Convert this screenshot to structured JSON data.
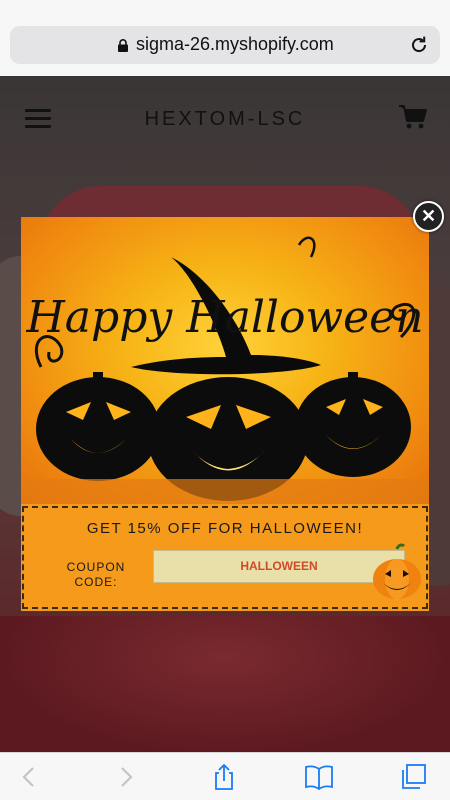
{
  "browser": {
    "url": "sigma-26.myshopify.com"
  },
  "header": {
    "brand": "HEXTOM-LSC"
  },
  "popup": {
    "offer_title": "GET 15% OFF FOR HALLOWEEN!",
    "coupon_label": "COUPON CODE:",
    "coupon_code": "HALLOWEEN",
    "close_symbol": "✕",
    "banner_text": "Happy Halloween"
  },
  "icons": {
    "lock": "lock-icon",
    "reload": "reload-icon",
    "menu": "hamburger-menu-icon",
    "cart": "cart-icon",
    "back": "back-icon",
    "forward": "forward-icon",
    "share": "share-icon",
    "bookmarks": "bookmarks-icon",
    "tabs": "tabs-icon"
  },
  "colors": {
    "popup_orange": "#f39a1c",
    "coupon_text": "#d04a28",
    "safari_blue": "#1a7cf5"
  }
}
